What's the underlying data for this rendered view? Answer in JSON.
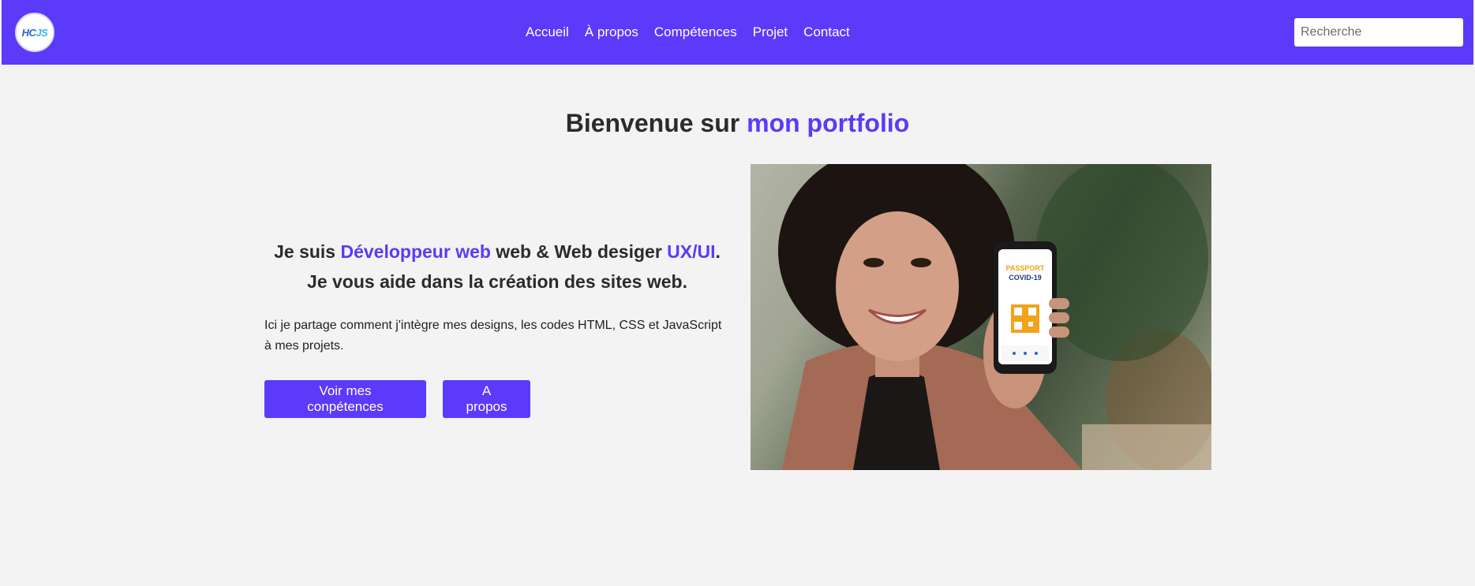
{
  "navbar": {
    "logo_text": "HCJS",
    "logo_parts": {
      "h": "HC",
      "j": "JS"
    },
    "links": [
      "Accueil",
      "À propos",
      "Compétences",
      "Projet",
      "Contact"
    ],
    "search_placeholder": "Recherche",
    "background_color": "#5b3af9"
  },
  "hero": {
    "title_prefix": "Bienvenue sur ",
    "title_accent": "mon portfolio",
    "heading": {
      "part1": "Je suis ",
      "accent1": "Développeur web",
      "part2": " web & Web desiger ",
      "accent2": "UX/UI",
      "part3": ". Je vous aide dans la création des sites web."
    },
    "description": "Ici je partage comment j'intègre mes designs, les codes HTML, CSS et JavaScript à mes projets.",
    "buttons": {
      "skills_label": "Voir mes conpétences",
      "about_label": "A propos"
    },
    "image": {
      "phone_line1": "PASSPORT",
      "phone_line2": "COVID-19"
    },
    "accent_color": "#5b3af9"
  }
}
